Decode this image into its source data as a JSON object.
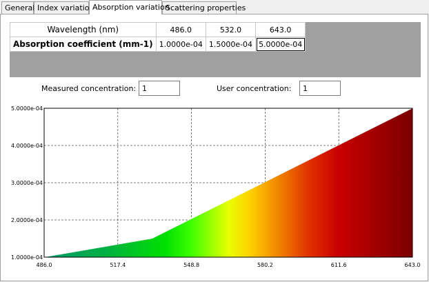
{
  "tabs": [
    {
      "label": "General"
    },
    {
      "label": "Index variation"
    },
    {
      "label": "Absorption variation",
      "active": true
    },
    {
      "label": "Scattering properties"
    }
  ],
  "table": {
    "row1_header": "Wavelength (nm)",
    "row2_header": "Absorption coefficient (mm-1)",
    "wavelengths": [
      "486.0",
      "532.0",
      "643.0"
    ],
    "coefficients": [
      "1.0000e-04",
      "1.5000e-04",
      "5.0000e-04"
    ]
  },
  "measured_concentration": {
    "label": "Measured concentration:",
    "value": "1"
  },
  "user_concentration": {
    "label": "User concentration:",
    "value": "1"
  },
  "chart_data": {
    "type": "area",
    "x": [
      486.0,
      532.0,
      643.0
    ],
    "y": [
      0.0001,
      0.00015,
      0.0005
    ],
    "xlim": [
      486.0,
      643.0
    ],
    "ylim": [
      0.0001,
      0.0005
    ],
    "x_ticks": [
      "486.0",
      "517.4",
      "548.8",
      "580.2",
      "611.6",
      "643.0"
    ],
    "y_ticks": [
      "1.0000e-04",
      "2.0000e-04",
      "3.0000e-04",
      "4.0000e-04",
      "5.0000e-04"
    ],
    "fill": "spectral color gradient by wavelength",
    "grid": true
  }
}
